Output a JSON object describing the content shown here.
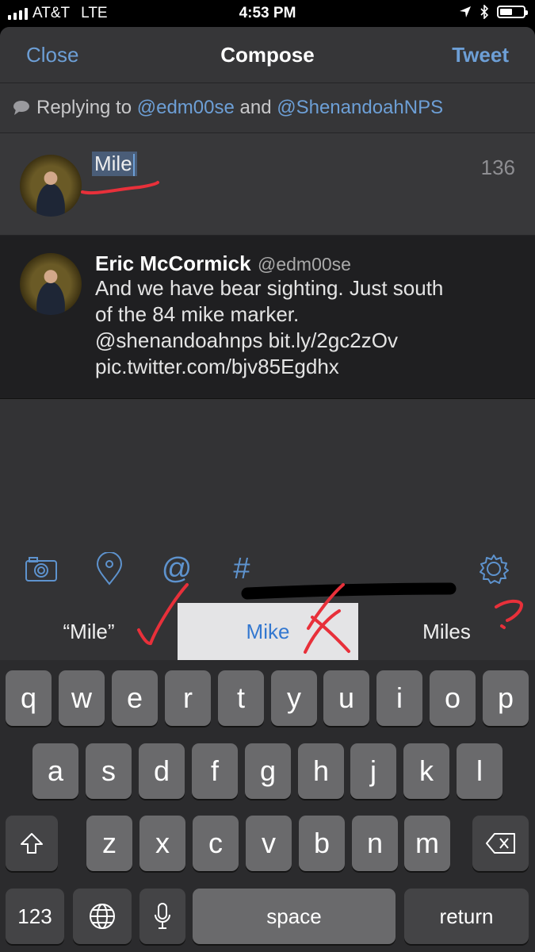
{
  "status_bar": {
    "carrier": "AT&T",
    "network": "LTE",
    "time": "4:53 PM",
    "icons": [
      "location-arrow-icon",
      "bluetooth-icon",
      "battery-icon"
    ],
    "battery_level": 0.55
  },
  "navbar": {
    "close_label": "Close",
    "title": "Compose",
    "tweet_label": "Tweet"
  },
  "reply": {
    "prefix": "Replying to",
    "user1": "@edm00se",
    "conjunction": "and",
    "user2": "@ShenandoahNPS"
  },
  "composer": {
    "text": "Mile",
    "char_count": "136"
  },
  "quoted_tweet": {
    "name": "Eric McCormick",
    "handle": "@edm00se",
    "lines": [
      "And we have bear sighting. Just south",
      "of the 84 mike marker.",
      "@shenandoahnps bit.ly/2gc2zOv",
      "pic.twitter.com/bjv85Egdhx"
    ]
  },
  "toolbar": {
    "icons": [
      "camera-icon",
      "location-pin-icon",
      "at-sign-icon",
      "hashtag-icon",
      "gear-icon"
    ],
    "at_symbol": "@",
    "hash_symbol": "#"
  },
  "suggestions": [
    {
      "label": "“Mile”",
      "selected": false
    },
    {
      "label": "Mike",
      "selected": true
    },
    {
      "label": "Miles",
      "selected": false
    }
  ],
  "keyboard": {
    "row1": [
      "q",
      "w",
      "e",
      "r",
      "t",
      "y",
      "u",
      "i",
      "o",
      "p"
    ],
    "row2": [
      "a",
      "s",
      "d",
      "f",
      "g",
      "h",
      "j",
      "k",
      "l"
    ],
    "row3": [
      "z",
      "x",
      "c",
      "v",
      "b",
      "n",
      "m"
    ],
    "numbers_label": "123",
    "space_label": "space",
    "return_label": "return"
  },
  "colors": {
    "accent": "#6d9fd6",
    "background": "#333335",
    "keyboard": "#2b2b2d",
    "annotation_red": "#e8303a"
  }
}
